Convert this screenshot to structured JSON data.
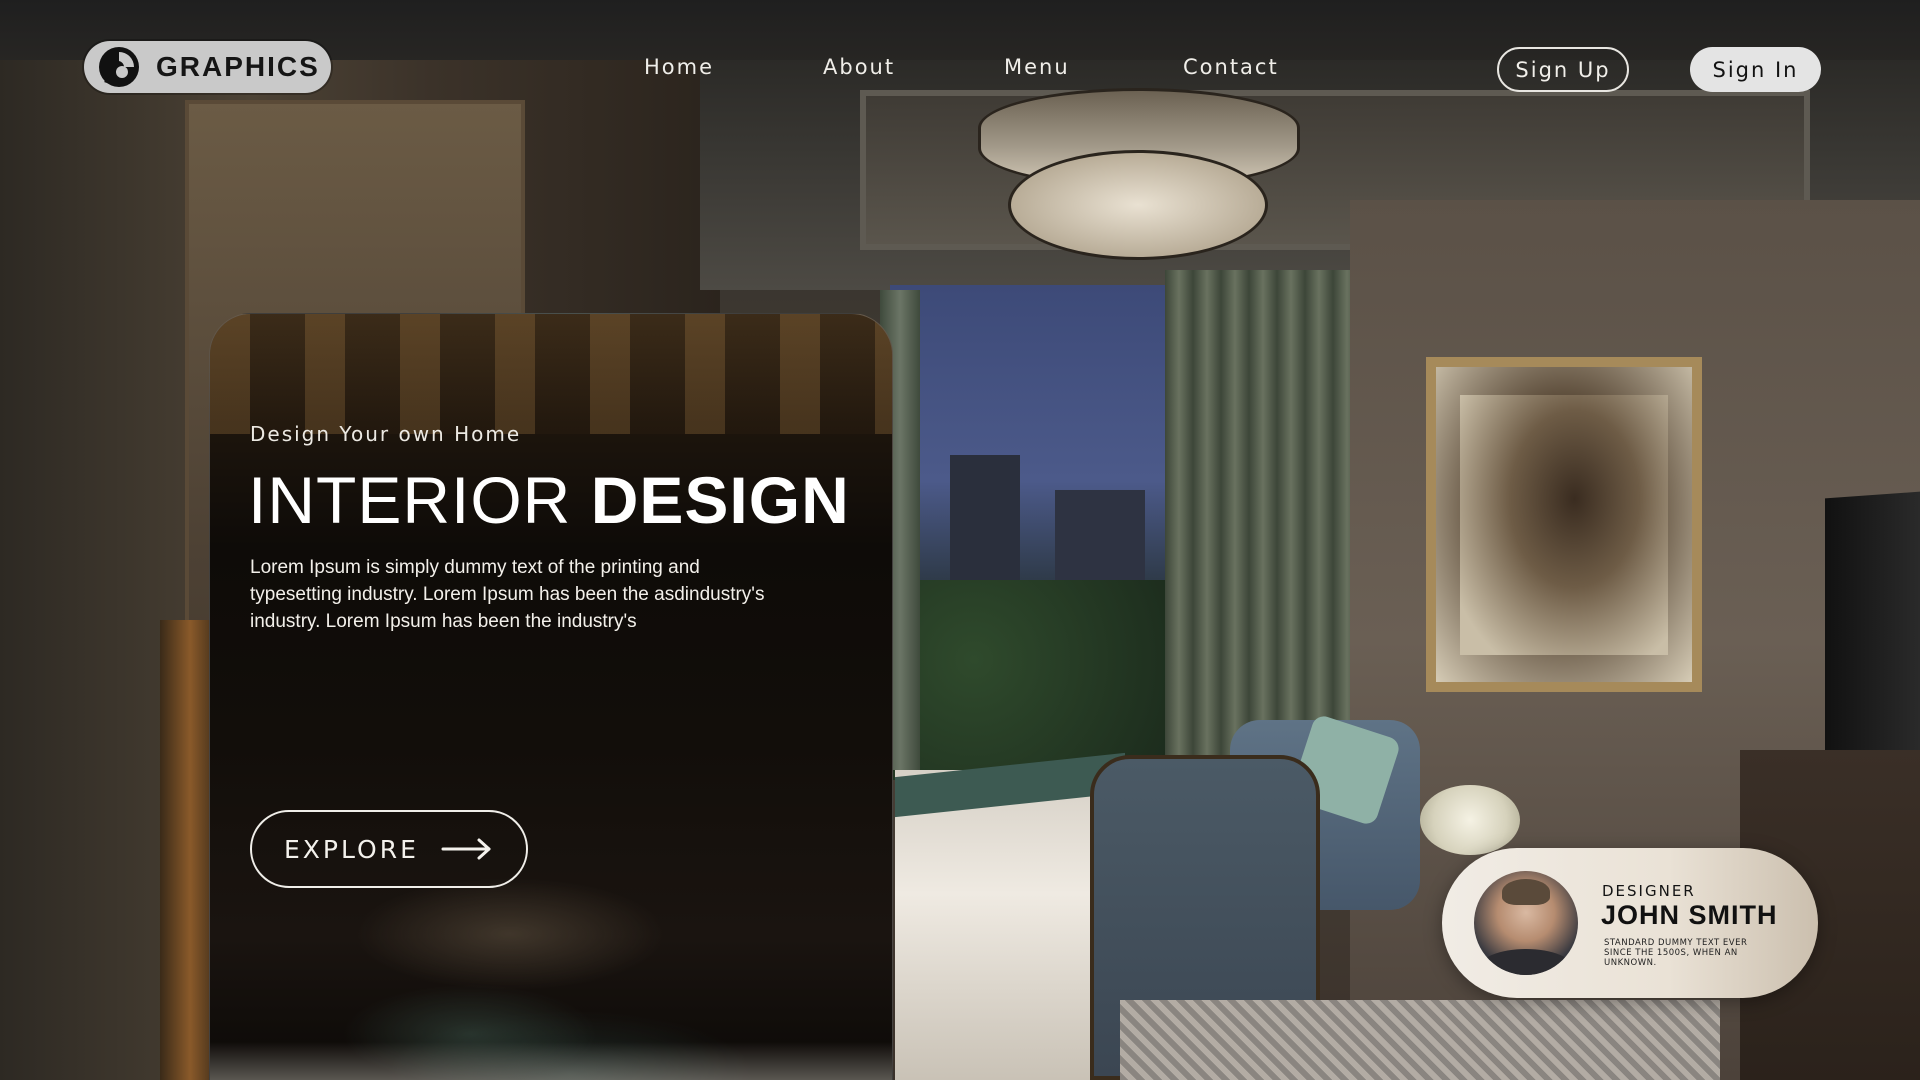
{
  "brand": {
    "name": "GRAPHICS",
    "logo_icon": "brand-logo-mark",
    "pill_color": "#c9c9c9"
  },
  "nav": {
    "links": [
      {
        "label": "Home"
      },
      {
        "label": "About"
      },
      {
        "label": "Menu"
      },
      {
        "label": "Contact"
      }
    ],
    "sign_up_label": "Sign Up",
    "sign_in_label": "Sign In"
  },
  "hero": {
    "kicker": "Design Your own Home",
    "title_light": "INTERIOR",
    "title_bold": "DESIGN",
    "body": "Lorem Ipsum is simply dummy text of the printing and typesetting industry. Lorem Ipsum has been the asdindustry's  industry. Lorem Ipsum has been the industry's",
    "cta_label": "EXPLORE",
    "cta_icon": "arrow-right-icon"
  },
  "designer": {
    "role": "DESIGNER",
    "name": "JOHN SMITH",
    "bio": "STANDARD DUMMY TEXT EVER SINCE THE 1500S, WHEN AN UNKNOWN."
  },
  "colors": {
    "text_light": "#f0eee9",
    "button_solid_bg": "#e4e4e4",
    "card_bg": "#0e0b08"
  }
}
